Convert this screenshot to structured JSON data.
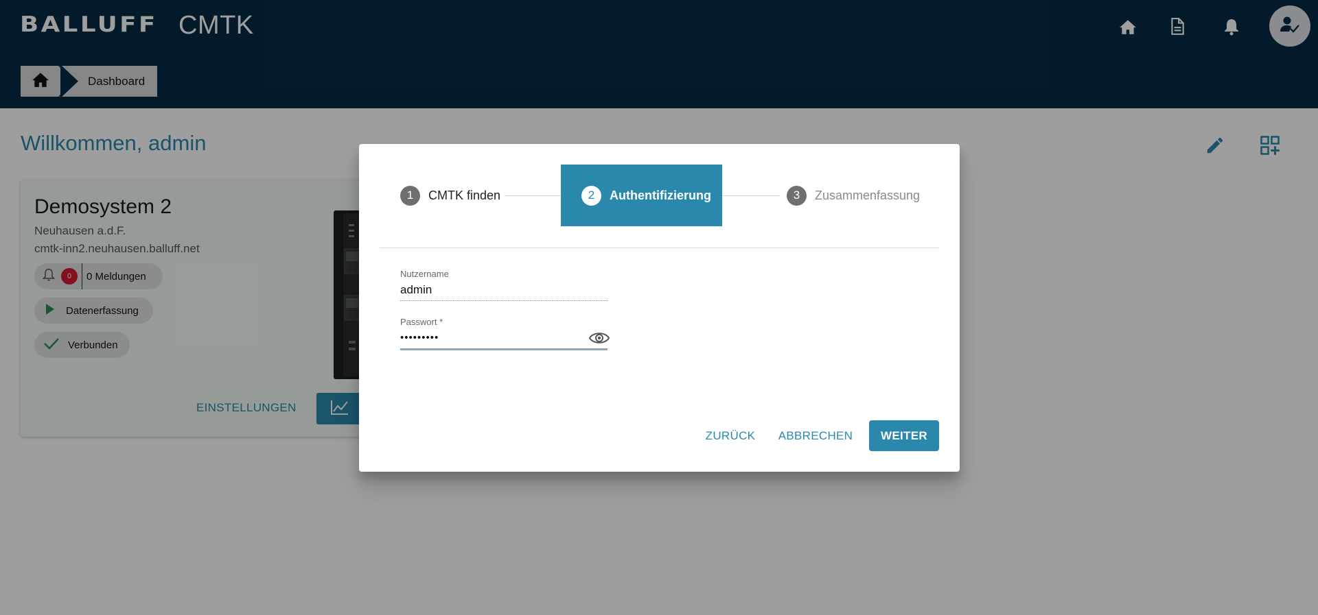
{
  "header": {
    "brand": "BALLUFF",
    "app_title": "CMTK",
    "icons": [
      "home-icon",
      "document-icon",
      "bell-icon",
      "user-check-icon"
    ]
  },
  "breadcrumb": {
    "home_icon": "home-icon",
    "current": "Dashboard"
  },
  "main": {
    "welcome": "Willkommen, admin",
    "actions": [
      "edit-icon",
      "grid-add-icon"
    ]
  },
  "card": {
    "title": "Demosystem 2",
    "location": "Neuhausen a.d.F.",
    "host": "cmtk-inn2.neuhausen.balluff.net",
    "notifications_count": "0",
    "notifications_label": "0 Meldungen",
    "acquisition_label": "Datenerfassung",
    "status_label": "Verbunden",
    "settings_label": "EINSTELLUNGEN"
  },
  "dialog": {
    "steps": [
      {
        "number": "1",
        "label": "CMTK finden",
        "state": "done"
      },
      {
        "number": "2",
        "label": "Authentifizierung",
        "state": "active"
      },
      {
        "number": "3",
        "label": "Zusammenfassung",
        "state": "pending"
      }
    ],
    "username_label": "Nutzername",
    "username_value": "admin",
    "password_label": "Passwort *",
    "password_value": "•••••••••",
    "back_label": "ZURÜCK",
    "cancel_label": "ABBRECHEN",
    "next_label": "WEITER"
  },
  "colors": {
    "header_bg": "#052b45",
    "accent": "#2a88ad",
    "badge_red": "#d41934",
    "card_bg": "#f4fbf5"
  }
}
